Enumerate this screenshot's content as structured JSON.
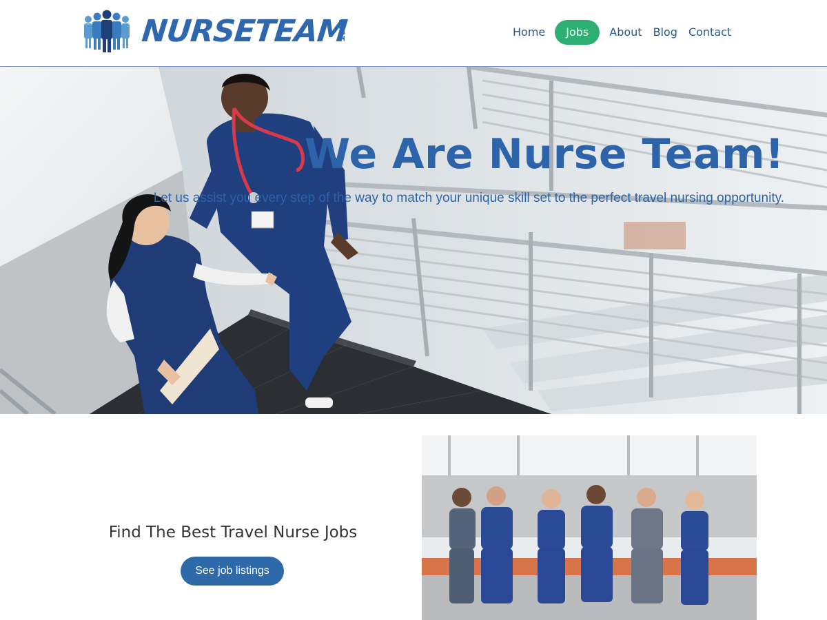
{
  "brand": {
    "logo_text": "NURSETEAM",
    "logo_suffix": ".NET",
    "color": "#2e67ad"
  },
  "nav": {
    "items": [
      {
        "label": "Home",
        "active": false
      },
      {
        "label": "Jobs",
        "active": true
      },
      {
        "label": "About",
        "active": false
      },
      {
        "label": "Blog",
        "active": false
      },
      {
        "label": "Contact",
        "active": false
      }
    ],
    "active_color": "#2dae73",
    "link_color": "#275b8e"
  },
  "hero": {
    "title": "We Are Nurse Team!",
    "subtitle": "Let us assist you every step of the way to match your unique skill set to the perfect travel nursing opportunity.",
    "text_color": "#2d63a8"
  },
  "jobs": {
    "heading": "Find The Best Travel Nurse Jobs",
    "button_label": "See job listings",
    "button_color": "#2e6aa9"
  },
  "icons": [
    "nurse-team-logo-icon",
    "stethoscope-icon"
  ]
}
